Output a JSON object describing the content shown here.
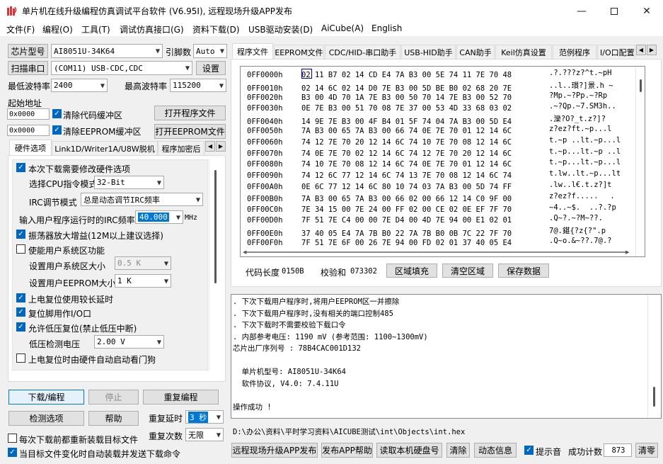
{
  "title": "单片机在线升级编程仿真调试平台软件 (V6.95I), 远程现场升级APP发布",
  "menu": [
    "文件(F)",
    "编程(O)",
    "工具(T)",
    "调试仿真接口(G)",
    "资料下载(D)",
    "USB驱动安装(D)",
    "AiCube(A)",
    "English"
  ],
  "left": {
    "chip_label": "芯片型号",
    "chip_value": "AI8051U-34K64",
    "pin_label": "引脚数",
    "pin_value": "Auto",
    "scan_label": "扫描串口",
    "port_value": "(COM11) USB-CDC,CDC",
    "settings_label": "设置",
    "min_baud_label": "最低波特率",
    "min_baud_value": "2400",
    "max_baud_label": "最高波特率",
    "max_baud_value": "115200",
    "start_addr_label": "起始地址",
    "addr1": "0x0000",
    "clear_code_label": "清除代码缓冲区",
    "open_prog_label": "打开程序文件",
    "addr2": "0x0000",
    "clear_eeprom_label": "清除EEPROM缓冲区",
    "open_eeprom_label": "打开EEPROM文件",
    "tabs": [
      "硬件选项",
      "Link1D/Writer1A/U8W脱机",
      "程序加密后"
    ],
    "options": {
      "modify_hw": "本次下载需要修改硬件选项",
      "cpu_mode_label": "选择CPU指令模式",
      "cpu_mode_value": "32-Bit",
      "irc_mode_label": "IRC调节模式",
      "irc_mode_value": "总是动态调节IRC频率",
      "irc_freq_label": "输入用户程序运行时的IRC频率",
      "irc_freq_value": "40.000",
      "irc_unit": "MHz",
      "osc_gain": "振荡器放大增益(12M以上建议选择)",
      "use_sys_area": "使能用户系统区功能",
      "sys_area_size_label": "设置用户系统区大小",
      "sys_area_size_value": "0.5 K",
      "eeprom_size_label": "设置用户EEPROM大小",
      "eeprom_size_value": "1   K",
      "long_delay": "上电复位使用较长延时",
      "reset_io": "复位脚用作I/O口",
      "allow_lvr": "允许低压复位(禁止低压中断)",
      "lvd_label": "低压检测电压",
      "lvd_value": "2.00 V",
      "watchdog": "上电复位时由硬件自动启动看门狗"
    },
    "download_label": "下载/编程",
    "stop_label": "停止",
    "reprog_label": "重复编程",
    "detect_label": "检测选项",
    "help_label": "帮助",
    "repeat_delay_label": "重复延时",
    "repeat_delay_value": "3 秒",
    "repeat_count_label": "重复次数",
    "repeat_count_value": "无限",
    "reload_label": "每次下载前都重新装载目标文件",
    "auto_send_label": "当目标文件变化时自动装载并发送下载命令"
  },
  "right_tabs": [
    "程序文件",
    "EEPROM文件",
    "CDC/HID-串口助手",
    "USB-HID助手",
    "CAN助手",
    "Keil仿真设置",
    "范例程序",
    "I/O口配置"
  ],
  "hex": [
    {
      "addr": "0FF0000h",
      "bytes": "02 11 B7 02 14 CD E4 7A B3 00 5E 74 11 7E 70 48",
      "ascii": ".?.???z?^t.~pH"
    },
    {
      "addr": "0FF0010h",
      "bytes": "02 14 6C 02 14 D0 7E B3 00 5D BE B0 02 68 20 7E",
      "ascii": "..l..瓆?]景.h ~"
    },
    {
      "addr": "0FF0020h",
      "bytes": "B3 00 4D 70 1A 7E B3 00 50 70 14 7E B3 00 52 70",
      "ascii": "?Mp.~?Pp.~?Rp"
    },
    {
      "addr": "0FF0030h",
      "bytes": "0E 7E B3 00 51 70 08 7E 37 00 53 4D 33 68 03 02",
      "ascii": ".~?Qp.~7.SM3h.."
    },
    {
      "addr": "0FF0040h",
      "bytes": "14 9E 7E B3 00 4F B4 01 5F 74 04 7A B3 00 5D E4",
      "ascii": ".灤?O?_t.z?]?"
    },
    {
      "addr": "0FF0050h",
      "bytes": "7A B3 00 65 7A B3 00 66 74 0E 7E 70 01 12 14 6C",
      "ascii": "z?ez?ft.~p...l"
    },
    {
      "addr": "0FF0060h",
      "bytes": "74 12 7E 70 20 12 14 6C 74 10 7E 70 08 12 14 6C",
      "ascii": "t.~p ..lt.~p...l"
    },
    {
      "addr": "0FF0070h",
      "bytes": "74 0E 7E 70 02 12 14 6C 74 12 7E 70 20 12 14 6C",
      "ascii": "t.~p...lt.~p ..l"
    },
    {
      "addr": "0FF0080h",
      "bytes": "74 10 7E 70 08 12 14 6C 74 0E 7E 70 01 12 14 6C",
      "ascii": "t.~p...lt.~p...l"
    },
    {
      "addr": "0FF0090h",
      "bytes": "74 12 6C 77 12 14 6C 74 13 7E 70 08 12 14 6C 74",
      "ascii": "t.lw..lt.~p...lt"
    },
    {
      "addr": "0FF00A0h",
      "bytes": "0E 6C 77 12 14 6C 80 10 74 03 7A B3 00 5D 74 FF",
      "ascii": ".lw..l€.t.z?]t"
    },
    {
      "addr": "0FF00B0h",
      "bytes": "7A B3 00 65 7A B3 00 66 02 00 66 12 14 C0 9F 00",
      "ascii": "z?ez?f......"
    },
    {
      "addr": "0FF00C0h",
      "bytes": "7E 34 15 00 7E 24 00 FF 02 00 CE 02 0E EF 7F 70",
      "ascii": "~4..~$.  ..?.?p"
    },
    {
      "addr": "0FF00D0h",
      "bytes": "7F 51 7E C4 00 00 7E D4 00 4D 7E 94 00 E1 02 01",
      "ascii": ".Q~?.~?M~??."
    },
    {
      "addr": "0FF00E0h",
      "bytes": "37 40 05 E4 7A 7B B0 22 7A 7B B0 0B 7C 22 7F 70",
      "ascii": "7@.鍖{?z{?\".p"
    },
    {
      "addr": "0FF00F0h",
      "bytes": "7F 51 7E 6F 00 26 7E 94 00 FD 02 01 37 40 05 E4",
      "ascii": ".Q~o.&~??.7@.?"
    }
  ],
  "code_len_label": "代码长度",
  "code_len_value": "0150B",
  "checksum_label": "校验和",
  "checksum_value": "073302",
  "fill_label": "区域填充",
  "clear_area_label": "清空区域",
  "save_data_label": "保存数据",
  "log": [
    ". 下次下载用户程序时,将用户EEPROM区一并擦除",
    ". 下次下载用户程序时,没有相关的端口控制485",
    ". 下次下载时不需要校验下载口令",
    ". 内部参考电压: 1190 mV (参考范围: 1100~1300mV)",
    "芯片出厂序列号 : 78B4CAC001D132",
    "",
    "  单片机型号: AI8051U-34K64",
    "  软件协议, V4.0: 7.4.11U",
    "",
    "操作成功 !"
  ],
  "path": "D:\\办公\\资料\\平时学习资料\\AICUBE测试\\int\\Objects\\int.hex",
  "bottom": {
    "publish_label": "远程现场升级APP发布",
    "publish_help_label": "发布APP帮助",
    "read_disk_label": "读取本机硬盘号",
    "clear_label": "清除",
    "anim_label": "动态信息",
    "beep_label": "提示音",
    "success_label": "成功计数",
    "success_value": "873",
    "clear2_label": "清零"
  }
}
